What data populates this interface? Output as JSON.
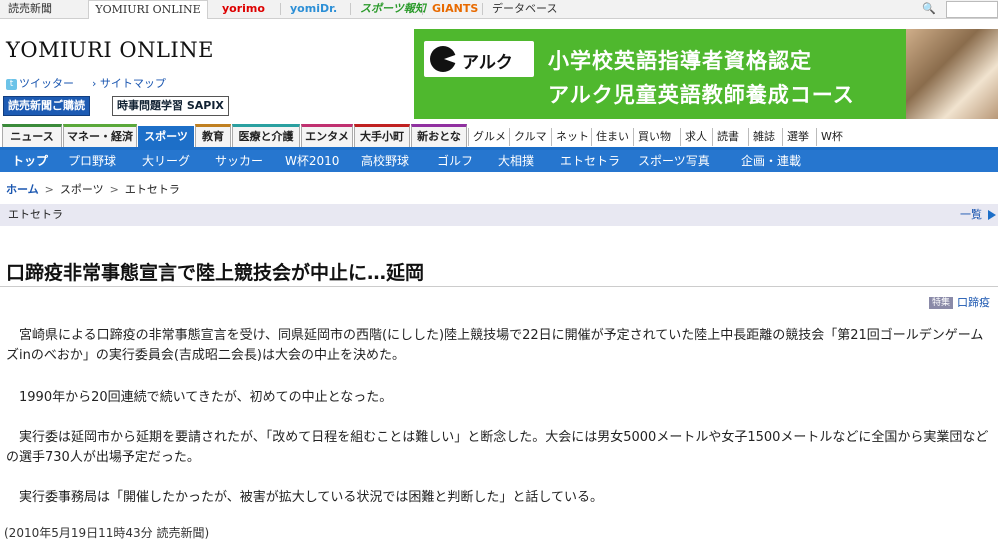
{
  "topbar": {
    "yomiuri": "読売新聞",
    "online": "YOMIURI ONLINE",
    "yorimo": "yorimo",
    "yomidr": "yomiDr.",
    "hochi": "スポーツ報知",
    "giants": "GIANTS",
    "database": "データベース"
  },
  "header": {
    "logo": "YOMIURI ONLINE",
    "twitter": "ツイッター",
    "sitemap": "サイトマップ",
    "subscribe": "読売新聞ご購読",
    "sapix": "時事問題学習 SAPIX"
  },
  "ad": {
    "brand": "アルク",
    "line1": "小学校英語指導者資格認定",
    "line2": "アルク児童英語教師養成コース"
  },
  "categories": [
    "ニュース",
    "マネー・経済",
    "スポーツ",
    "教育",
    "医療と介護",
    "エンタメ",
    "大手小町",
    "新おとな"
  ],
  "subcategories": [
    "グルメ",
    "クルマ",
    "ネット",
    "住まい",
    "買い物",
    "求人",
    "読書",
    "雑誌",
    "選挙",
    "W杯"
  ],
  "sports_nav": [
    "トップ",
    "プロ野球",
    "大リーグ",
    "サッカー",
    "W杯2010",
    "高校野球",
    "ゴルフ",
    "大相撲",
    "エトセトラ",
    "スポーツ写真",
    "企画・連載"
  ],
  "breadcrumb": {
    "home": "ホーム",
    "sports": "スポーツ",
    "current": "エトセトラ"
  },
  "section": {
    "title": "エトセトラ",
    "list_link": "一覧"
  },
  "article": {
    "headline": "口蹄疫非常事態宣言で陸上競技会が中止に…延岡",
    "tag_badge": "特集",
    "tag_label": "口蹄疫",
    "p1": "宮崎県による口蹄疫の非常事態宣言を受け、同県延岡市の西階(にしした)陸上競技場で22日に開催が予定されていた陸上中長距離の競技会「第21回ゴールデンゲームズinのべおか」の実行委員会(吉成昭二会長)は大会の中止を決めた。",
    "p2": "1990年から20回連続で続いてきたが、初めての中止となった。",
    "p3": "実行委は延岡市から延期を要請されたが、「改めて日程を組むことは難しい」と断念した。大会には男女5000メートルや女子1500メートルなどに全国から実業団などの選手730人が出場予定だった。",
    "p4": "実行委事務局は「開催したかったが、被害が拡大している状況では困難と判断した」と話している。",
    "date": "(2010年5月19日11時43分  読売新聞)"
  }
}
